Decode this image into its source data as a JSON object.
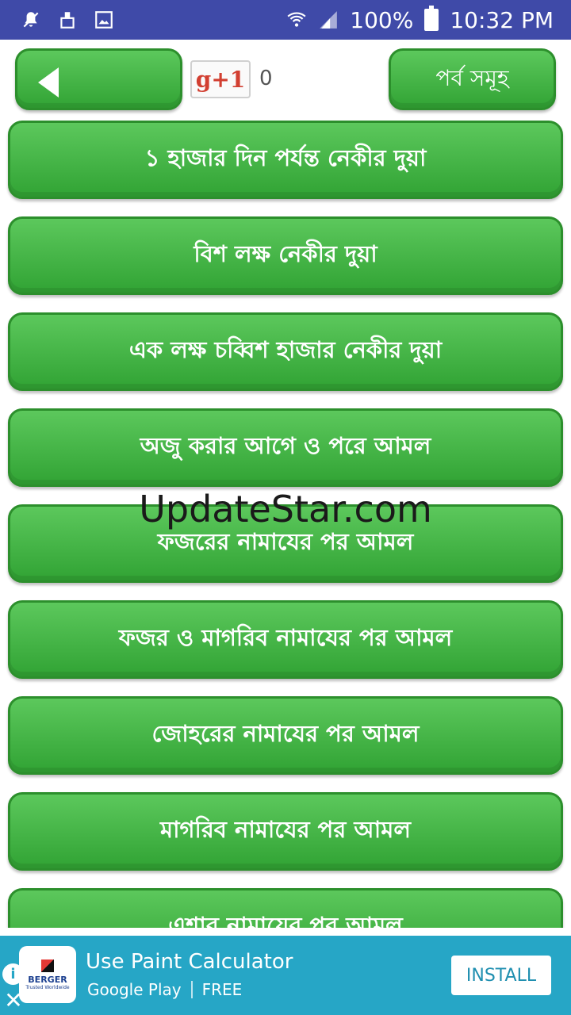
{
  "status_bar": {
    "battery": "100%",
    "time": "10:32 PM"
  },
  "header": {
    "gplus_label": "g+1",
    "gplus_count": "0",
    "episodes_label": "পর্ব সমূহ"
  },
  "list": {
    "items": [
      "১ হাজার দিন পর্যন্ত নেকীর দুয়া",
      "বিশ লক্ষ নেকীর দুয়া",
      "এক লক্ষ চব্বিশ হাজার নেকীর দুয়া",
      "অজু করার আগে ও পরে আমল",
      "ফজরের নামাযের পর আমল",
      "ফজর ও মাগরিব নামাযের পর আমল",
      "জোহরের নামাযের পর আমল",
      "মাগরিব নামাযের পর আমল",
      "এশার নামাযের পর আমল"
    ]
  },
  "watermark": "UpdateStar.com",
  "ad": {
    "brand": "BERGER",
    "brand_tag": "Trusted Worldwide",
    "title": "Use Paint Calculator",
    "store": "Google Play",
    "price": "FREE",
    "install_label": "INSTALL"
  },
  "colors": {
    "status_bar": "#3f4aa8",
    "button_green": "#3fb142",
    "ad_background": "#26a6c6"
  }
}
